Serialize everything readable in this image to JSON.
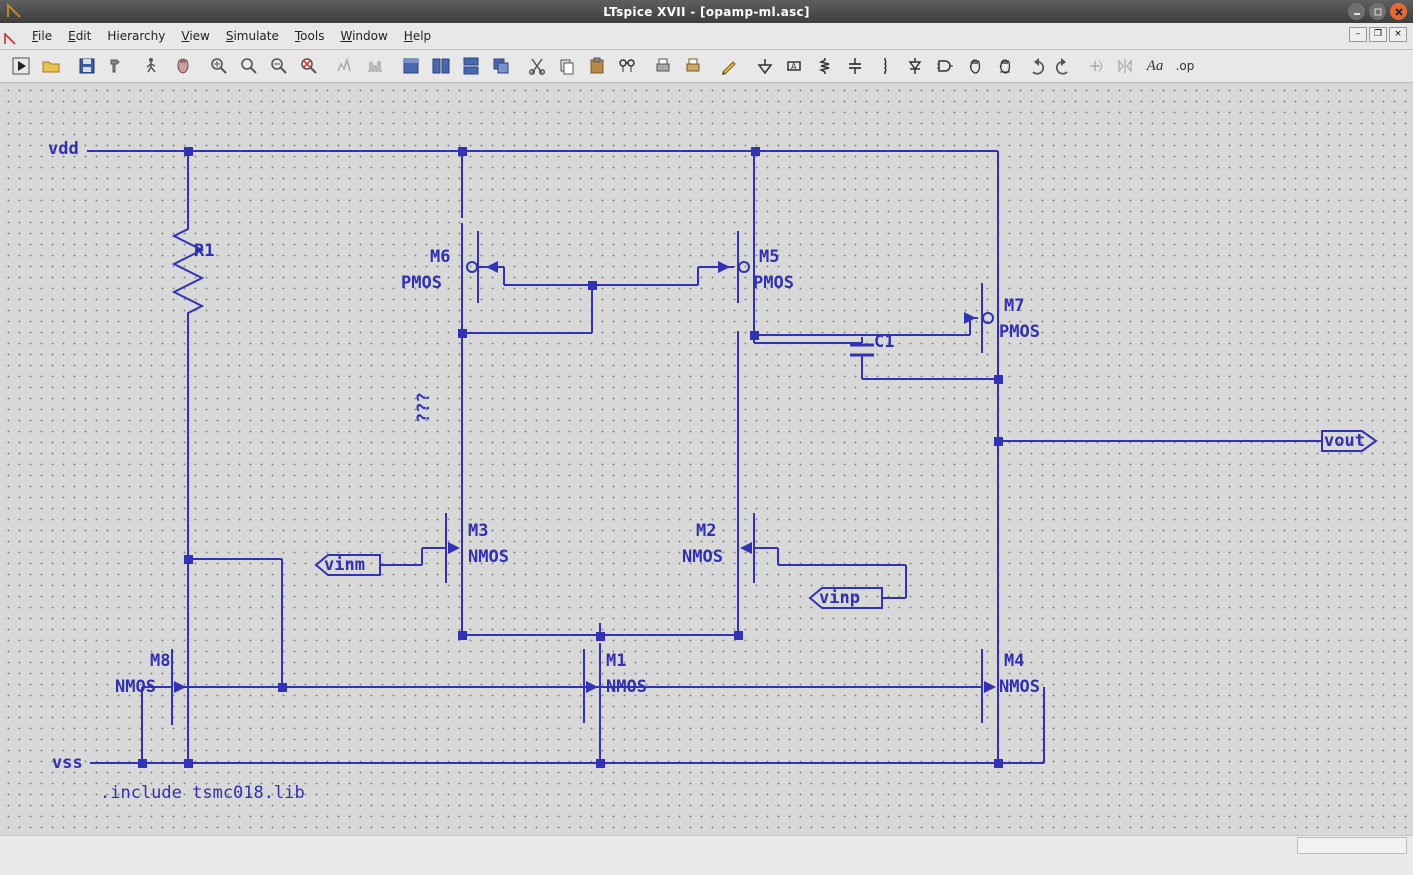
{
  "titlebar": {
    "title": "LTspice XVII - [opamp-ml.asc]"
  },
  "menus": {
    "file": "File",
    "edit": "Edit",
    "hierarchy": "Hierarchy",
    "view": "View",
    "simulate": "Simulate",
    "tools": "Tools",
    "window": "Window",
    "help": "Help"
  },
  "directive": ".include tsmc018.lib",
  "nets": {
    "vdd": "vdd",
    "vss": "vss",
    "vout": "vout",
    "vinm": "vinm",
    "vinp": "vinp"
  },
  "components": {
    "R1": {
      "name": "R1"
    },
    "C1": {
      "name": "C1"
    },
    "M1": {
      "name": "M1",
      "model": "NMOS"
    },
    "M2": {
      "name": "M2",
      "model": "NMOS"
    },
    "M3": {
      "name": "M3",
      "model": "NMOS"
    },
    "M4": {
      "name": "M4",
      "model": "NMOS"
    },
    "M5": {
      "name": "M5",
      "model": "PMOS"
    },
    "M6": {
      "name": "M6",
      "model": "PMOS"
    },
    "M7": {
      "name": "M7",
      "model": "PMOS"
    },
    "M8": {
      "name": "M8",
      "model": "NMOS"
    },
    "unknown_label": "???"
  }
}
